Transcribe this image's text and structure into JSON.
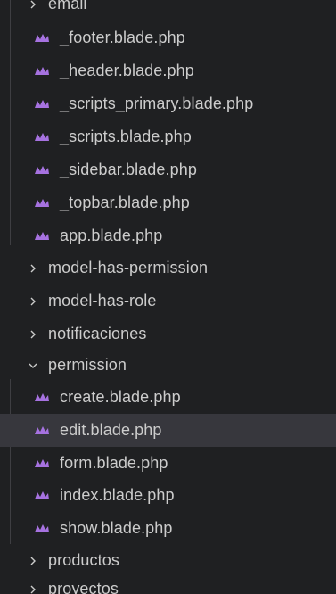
{
  "colors": {
    "background": "#1f2022",
    "selected_row": "#37373d",
    "text": "#cccccc",
    "blade_icon": "#a672e0",
    "indent_guide": "#3e3e42"
  },
  "tree": {
    "partial_top_folder": "email",
    "layout_files": [
      {
        "label": "_footer.blade.php",
        "icon": "blade-icon"
      },
      {
        "label": "_header.blade.php",
        "icon": "blade-icon"
      },
      {
        "label": "_scripts_primary.blade.php",
        "icon": "blade-icon"
      },
      {
        "label": "_scripts.blade.php",
        "icon": "blade-icon"
      },
      {
        "label": "_sidebar.blade.php",
        "icon": "blade-icon"
      },
      {
        "label": "_topbar.blade.php",
        "icon": "blade-icon"
      },
      {
        "label": "app.blade.php",
        "icon": "blade-icon"
      }
    ],
    "folders_collapsed": [
      {
        "label": "model-has-permission",
        "icon": "chevron-right-icon"
      },
      {
        "label": "model-has-role",
        "icon": "chevron-right-icon"
      },
      {
        "label": "notificaciones",
        "icon": "chevron-right-icon"
      }
    ],
    "open_folder": {
      "label": "permission",
      "icon": "chevron-down-icon"
    },
    "permission_files": [
      {
        "label": "create.blade.php",
        "icon": "blade-icon",
        "selected": false
      },
      {
        "label": "edit.blade.php",
        "icon": "blade-icon",
        "selected": true
      },
      {
        "label": "form.blade.php",
        "icon": "blade-icon",
        "selected": false
      },
      {
        "label": "index.blade.php",
        "icon": "blade-icon",
        "selected": false
      },
      {
        "label": "show.blade.php",
        "icon": "blade-icon",
        "selected": false
      }
    ],
    "folders_after": [
      {
        "label": "productos",
        "icon": "chevron-right-icon"
      },
      {
        "label": "proyectos",
        "icon": "chevron-right-icon"
      }
    ]
  }
}
